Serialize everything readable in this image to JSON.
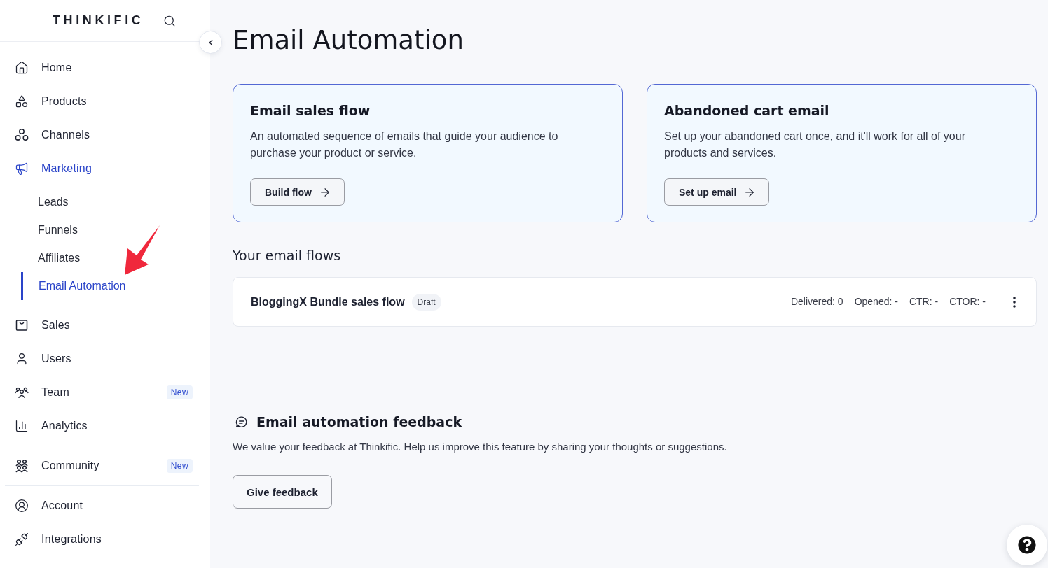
{
  "sidebar": {
    "logo": "THINKIFIC",
    "groups": [
      {
        "items": [
          {
            "label": "Home",
            "selected": false
          },
          {
            "label": "Products",
            "selected": false
          },
          {
            "label": "Channels",
            "selected": false
          },
          {
            "label": "Marketing",
            "selected": true,
            "children": [
              {
                "label": "Leads",
                "selected": false
              },
              {
                "label": "Funnels",
                "selected": false
              },
              {
                "label": "Affiliates",
                "selected": false
              },
              {
                "label": "Email Automation",
                "selected": true
              }
            ]
          },
          {
            "label": "Sales",
            "selected": false
          },
          {
            "label": "Users",
            "selected": false
          },
          {
            "label": "Team",
            "selected": false,
            "badge": "New"
          },
          {
            "label": "Analytics",
            "selected": false
          }
        ]
      },
      {
        "items": [
          {
            "label": "Community",
            "selected": false,
            "badge": "New"
          }
        ]
      },
      {
        "items": [
          {
            "label": "Account",
            "selected": false
          },
          {
            "label": "Integrations",
            "selected": false
          }
        ]
      }
    ]
  },
  "page": {
    "title": "Email Automation"
  },
  "cards": [
    {
      "title": "Email sales flow",
      "description": "An automated sequence of emails that guide your audience to purchase your product or service.",
      "button": "Build flow"
    },
    {
      "title": "Abandoned cart email",
      "description": "Set up your abandoned cart once, and it'll work for all of your products and services.",
      "button": "Set up email"
    }
  ],
  "flows": {
    "heading": "Your email flows",
    "rows": [
      {
        "name": "BloggingX Bundle sales flow",
        "status": "Draft",
        "stats": [
          "Delivered: 0",
          "Opened: -",
          "CTR: -",
          "CTOR: -"
        ]
      }
    ]
  },
  "feedback": {
    "title": "Email automation feedback",
    "text": "We value your feedback at Thinkific. Help us improve this feature by sharing your thoughts or suggestions.",
    "button": "Give feedback"
  }
}
